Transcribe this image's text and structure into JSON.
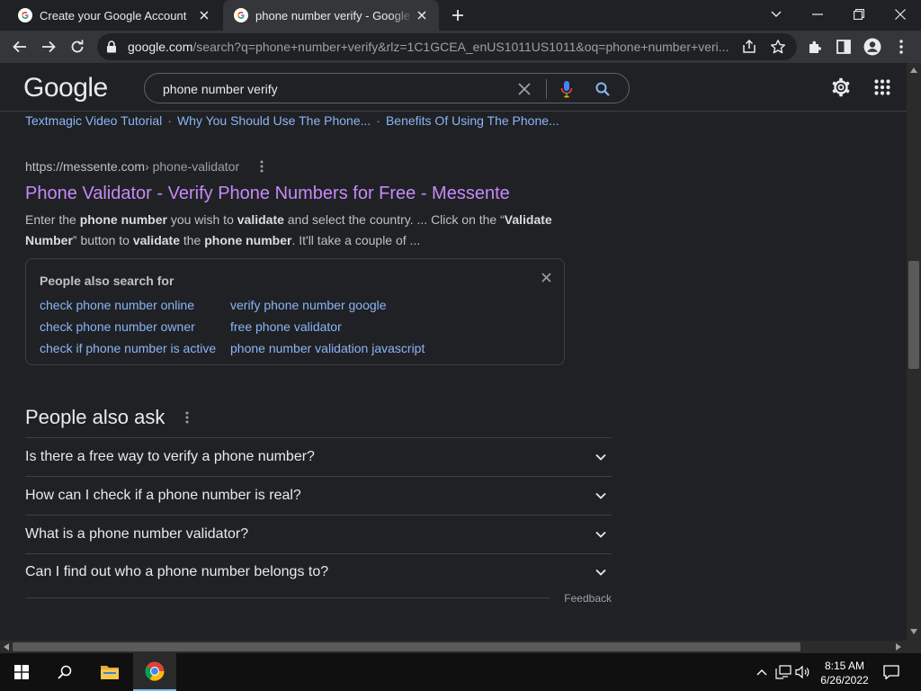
{
  "browser": {
    "tabs": [
      {
        "title": "Create your Google Account",
        "active": false
      },
      {
        "title": "phone number verify - Google Search",
        "active": true
      }
    ],
    "url_host": "google.com",
    "url_rest": "/search?q=phone+number+verify&rlz=1C1GCEA_enUS1011US1011&oq=phone+number+veri..."
  },
  "google": {
    "logo": "Google",
    "query": "phone number verify"
  },
  "sitelinks": [
    "Textmagic Video Tutorial",
    "Why You Should Use The Phone...",
    "Benefits Of Using The Phone..."
  ],
  "sitelink_separator": "·",
  "result": {
    "cite_host": "https://messente.com",
    "cite_path": " › phone-validator",
    "title": "Phone Validator - Verify Phone Numbers for Free - Messente",
    "snippet_html": "Enter the <b>phone number</b> you wish to <b>validate</b> and select the country. ... Click on the “<b>Validate Number</b>” button to <b>validate</b> the <b>phone number</b>. It'll take a couple of ..."
  },
  "people_also_search": {
    "title": "People also search for",
    "left": [
      "check phone number online",
      "check phone number owner",
      "check if phone number is active"
    ],
    "right": [
      "verify phone number google",
      "free phone validator",
      "phone number validation javascript"
    ]
  },
  "people_also_ask": {
    "title": "People also ask",
    "questions": [
      "Is there a free way to verify a phone number?",
      "How can I check if a phone number is real?",
      "What is a phone number validator?",
      "Can I find out who a phone number belongs to?"
    ],
    "feedback": "Feedback"
  },
  "taskbar": {
    "time": "8:15 AM",
    "date": "6/26/2022"
  },
  "colors": {
    "link": "#8ab4f8",
    "visited_link": "#c58af9",
    "background": "#202124"
  }
}
